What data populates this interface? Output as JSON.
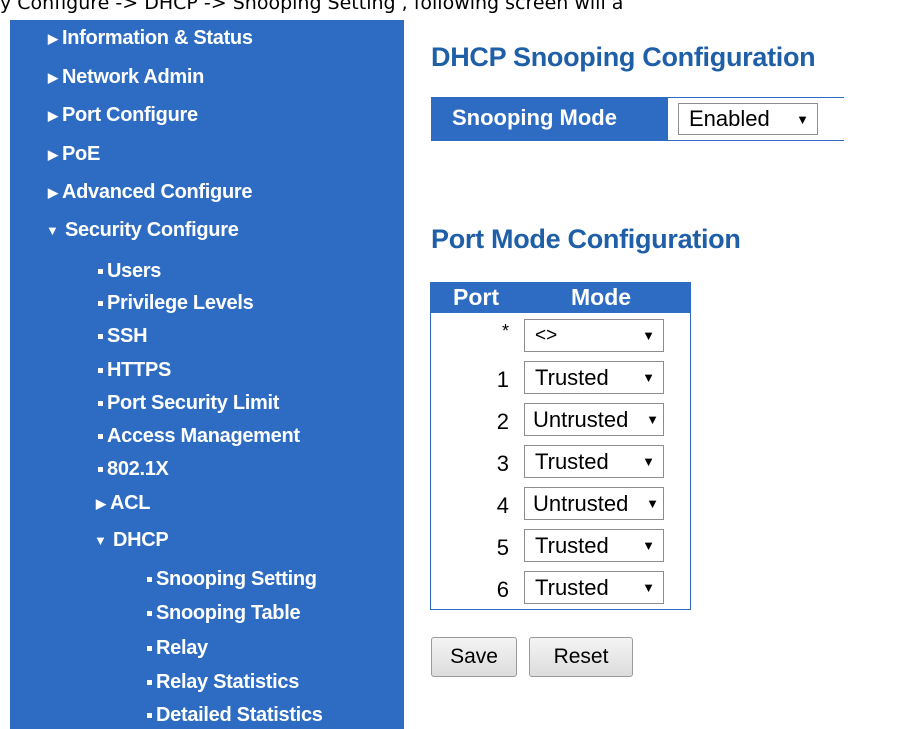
{
  "caption": "y Configure -> DHCP -> Snooping Setting , following screen will a",
  "sidebar": {
    "items": [
      {
        "label": "Information & Status"
      },
      {
        "label": "Network Admin"
      },
      {
        "label": "Port Configure"
      },
      {
        "label": "PoE"
      },
      {
        "label": "Advanced Configure"
      },
      {
        "label": "Security Configure"
      }
    ],
    "security_sub": [
      {
        "label": "Users"
      },
      {
        "label": "Privilege Levels"
      },
      {
        "label": "SSH"
      },
      {
        "label": "HTTPS"
      },
      {
        "label": "Port Security Limit"
      },
      {
        "label": "Access Management"
      },
      {
        "label": "802.1X"
      }
    ],
    "acl": {
      "label": "ACL"
    },
    "dhcp": {
      "label": "DHCP"
    },
    "dhcp_sub": [
      {
        "label": "Snooping Setting"
      },
      {
        "label": "Snooping Table"
      },
      {
        "label": "Relay"
      },
      {
        "label": "Relay Statistics"
      },
      {
        "label": "Detailed Statistics"
      }
    ]
  },
  "main": {
    "title": "DHCP Snooping Configuration",
    "snooping_mode_label": "Snooping Mode",
    "snooping_mode_value": "Enabled",
    "port_section_title": "Port Mode Configuration",
    "table": {
      "headers": [
        "Port",
        "Mode"
      ],
      "rows": [
        {
          "port": "*",
          "mode": "<>"
        },
        {
          "port": "1",
          "mode": "Trusted"
        },
        {
          "port": "2",
          "mode": "Untrusted"
        },
        {
          "port": "3",
          "mode": "Trusted"
        },
        {
          "port": "4",
          "mode": "Untrusted"
        },
        {
          "port": "5",
          "mode": "Trusted"
        },
        {
          "port": "6",
          "mode": "Trusted"
        }
      ]
    },
    "save_label": "Save",
    "reset_label": "Reset"
  },
  "colors": {
    "accent": "#2d6cc2",
    "heading": "#1f5fa8"
  }
}
